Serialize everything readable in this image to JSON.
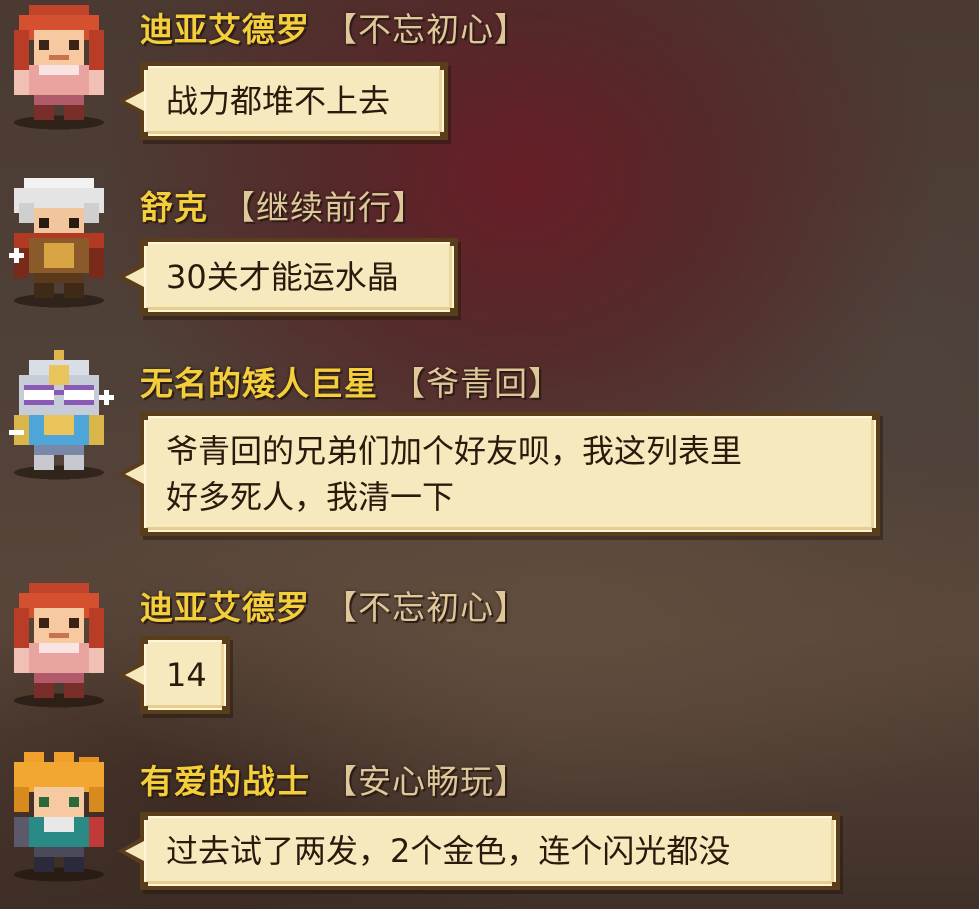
{
  "messages": [
    {
      "name": "迪亚艾德罗",
      "tag": "【不忘初心】",
      "lines": [
        "战力都堆不上去"
      ],
      "avatar": "red-haired-warrior-avatar"
    },
    {
      "name": "舒克",
      "tag": "【继续前行】",
      "lines": [
        "30关才能运水晶"
      ],
      "avatar": "white-haired-knight-avatar"
    },
    {
      "name": "无名的矮人巨星",
      "tag": "【爷青回】",
      "lines": [
        "爷青回的兄弟们加个好友呗，我这列表里",
        "好多死人，我清一下"
      ],
      "avatar": "dwarf-goggles-avatar"
    },
    {
      "name": "迪亚艾德罗",
      "tag": "【不忘初心】",
      "lines": [
        "14"
      ],
      "avatar": "red-haired-warrior-avatar"
    },
    {
      "name": "有爱的战士",
      "tag": "【安心畅玩】",
      "lines": [
        "过去试了两发，2个金色，连个闪光都没"
      ],
      "avatar": "orange-haired-fighter-avatar"
    }
  ],
  "colors": {
    "name": "#f4cf3b",
    "tag": "#e0c79a",
    "bubble_fill": "#f7e9be",
    "bubble_border": "#5a3e1c",
    "bubble_text": "#2a1a0c"
  }
}
